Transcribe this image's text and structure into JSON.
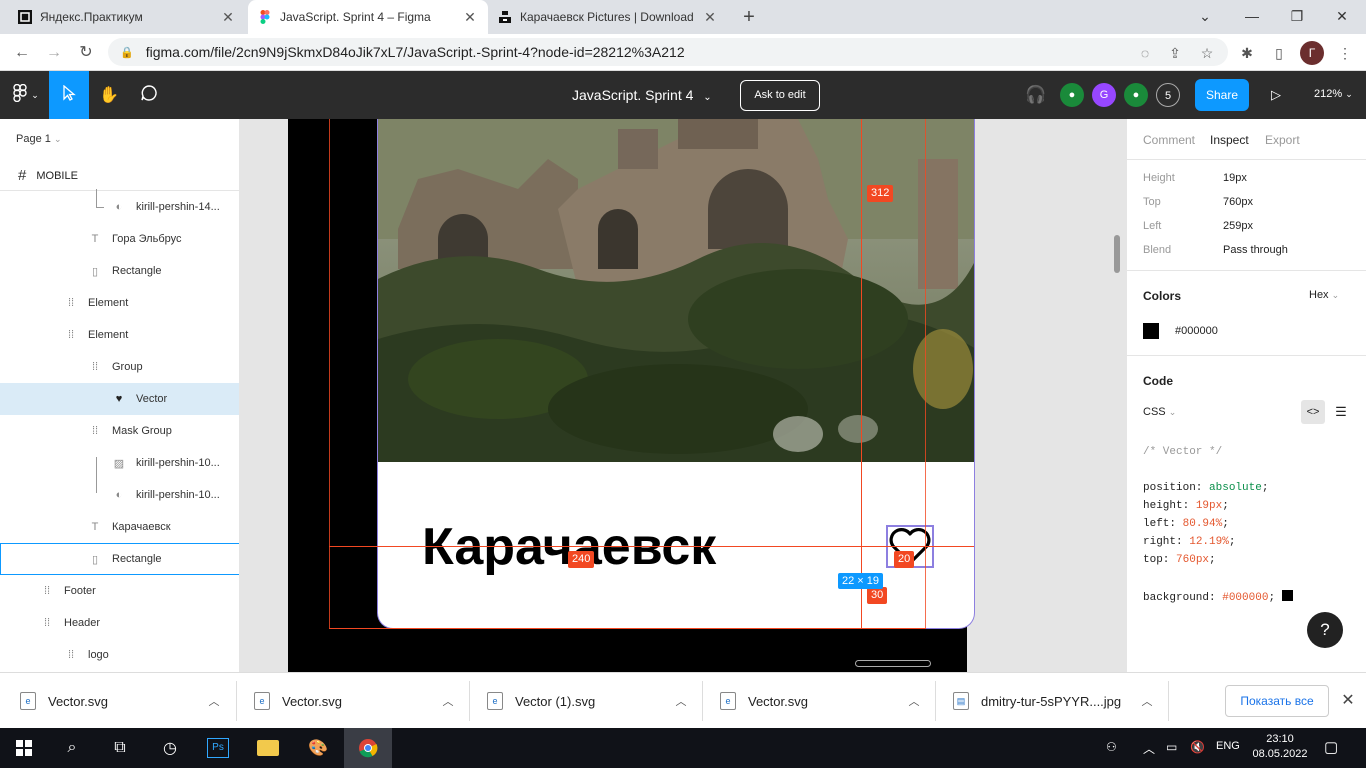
{
  "browser": {
    "tabs": [
      {
        "title": "Яндекс.Практикум",
        "active": false
      },
      {
        "title": "JavaScript. Sprint 4 – Figma",
        "active": true
      },
      {
        "title": "Карачаевск Pictures | Download",
        "active": false
      }
    ],
    "url": "figma.com/file/2cn9N9jSkmxD84oJik7xL7/JavaScript.-Sprint-4?node-id=28212%3A212",
    "profile_initial": "Г"
  },
  "toolbar": {
    "file_title": "JavaScript. Sprint 4",
    "ask_to_edit": "Ask to edit",
    "avatar_g": "G",
    "collab_count": "5",
    "share": "Share",
    "zoom": "212%"
  },
  "layers": {
    "page": "Page 1",
    "frame": "MOBILE",
    "items": [
      {
        "label": "kirill-pershin-14...",
        "icon": "mask-icon"
      },
      {
        "label": "Гора Эльбрус",
        "icon": "text-icon"
      },
      {
        "label": "Rectangle",
        "icon": "rectangle-icon"
      },
      {
        "label": "Element",
        "icon": "group-icon"
      },
      {
        "label": "Element",
        "icon": "group-icon"
      },
      {
        "label": "Group",
        "icon": "group-icon"
      },
      {
        "label": "Vector",
        "icon": "heart-icon"
      },
      {
        "label": "Mask Group",
        "icon": "group-icon"
      },
      {
        "label": "kirill-pershin-10...",
        "icon": "image-icon"
      },
      {
        "label": "kirill-pershin-10...",
        "icon": "mask-icon"
      },
      {
        "label": "Карачаевск",
        "icon": "text-icon"
      },
      {
        "label": "Rectangle",
        "icon": "rectangle-icon"
      },
      {
        "label": "Footer",
        "icon": "group-icon"
      },
      {
        "label": "Header",
        "icon": "group-icon"
      },
      {
        "label": "logo",
        "icon": "group-icon"
      }
    ]
  },
  "canvas": {
    "card_title": "Карачаевск",
    "measure_top": "312",
    "measure_left": "240",
    "measure_right": "20",
    "measure_bottom": "30",
    "size_label": "22 × 19"
  },
  "inspect": {
    "tabs": [
      "Comment",
      "Inspect",
      "Export"
    ],
    "props": [
      {
        "k": "Height",
        "v": "19px"
      },
      {
        "k": "Top",
        "v": "760px"
      },
      {
        "k": "Left",
        "v": "259px"
      },
      {
        "k": "Blend",
        "v": "Pass through"
      }
    ],
    "colors_title": "Colors",
    "color_format": "Hex",
    "color_value": "#000000",
    "code_title": "Code",
    "code_lang": "CSS",
    "code_comment": "/* Vector */",
    "code_lines": [
      {
        "p": "position:",
        "v": "absolute",
        "t": "kw"
      },
      {
        "p": "height:",
        "v": "19px",
        "t": "num"
      },
      {
        "p": "left:",
        "v": "80.94%",
        "t": "num"
      },
      {
        "p": "right:",
        "v": "12.19%",
        "t": "num"
      },
      {
        "p": "top:",
        "v": "760px",
        "t": "num"
      }
    ],
    "background_prop": "background:",
    "background_val": "#000000",
    "help": "?"
  },
  "downloads": {
    "items": [
      "Vector.svg",
      "Vector.svg",
      "Vector (1).svg",
      "Vector.svg",
      "dmitry-tur-5sPYYR....jpg"
    ],
    "show_all": "Показать все"
  },
  "taskbar": {
    "lang": "ENG",
    "time": "23:10",
    "date": "08.05.2022"
  },
  "colors": {
    "figma_blue": "#0d99ff",
    "measure_red": "#f24822",
    "toolbar_bg": "#2c2c2c"
  }
}
